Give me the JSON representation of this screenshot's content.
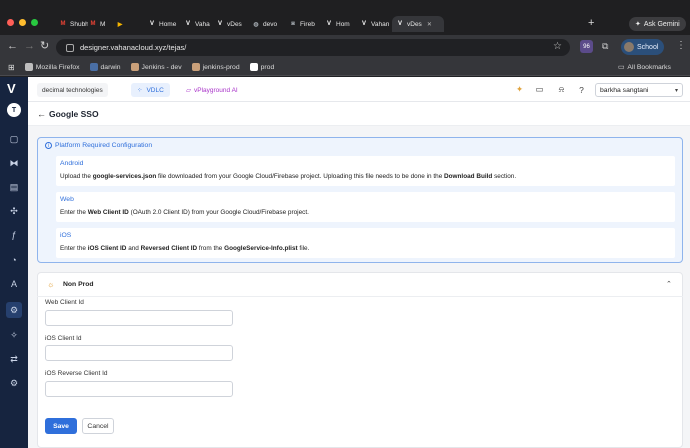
{
  "browser": {
    "tabs": [
      {
        "label": "Shubh",
        "icon": "gmail-icon",
        "color": "#ea4335",
        "glyph": "M"
      },
      {
        "label": "M",
        "icon": "gmail-icon",
        "color": "#ea4335",
        "glyph": "M"
      },
      {
        "label": "",
        "icon": "meet-icon",
        "color": "#f4b400",
        "glyph": "▶"
      },
      {
        "label": "Home",
        "icon": "vahana-icon",
        "color": "#ffffff",
        "glyph": "V"
      },
      {
        "label": "Vaha",
        "icon": "vahana-icon",
        "color": "#ffffff",
        "glyph": "V"
      },
      {
        "label": "vDes",
        "icon": "vahana-icon",
        "color": "#ffffff",
        "glyph": "V"
      },
      {
        "label": "devo",
        "icon": "globe-icon",
        "color": "#9aa0a6",
        "glyph": "◍"
      },
      {
        "label": "Fireb",
        "icon": "firebase-icon",
        "color": "#9aa0a6",
        "glyph": "◙"
      },
      {
        "label": "Hom",
        "icon": "vahana-icon",
        "color": "#ffffff",
        "glyph": "V"
      },
      {
        "label": "Vahan",
        "icon": "vahana-icon",
        "color": "#ffffff",
        "glyph": "V"
      },
      {
        "label": "vDes",
        "icon": "vahana-icon",
        "color": "#ffffff",
        "glyph": "V",
        "active": true
      }
    ],
    "gemini_label": "Ask Gemini",
    "url": "designer.vahanacloud.xyz/tejas/",
    "profile_label": "School",
    "extension_badge": "96",
    "bookmarks": [
      {
        "label": "Mozilla Firefox",
        "icon": "folder-icon",
        "color": "#bdbdbd"
      },
      {
        "label": "darwin",
        "icon": "d-icon",
        "color": "#4a6fa5"
      },
      {
        "label": "Jenkins - dev",
        "icon": "jenkins-icon",
        "color": "#c9a07a"
      },
      {
        "label": "jenkins-prod",
        "icon": "jenkins-icon",
        "color": "#c9a07a"
      },
      {
        "label": "prod",
        "icon": "vahana-icon",
        "color": "#ffffff"
      }
    ],
    "all_bookmarks": "All Bookmarks"
  },
  "app": {
    "org": "decimal technologies",
    "vdlc": "VDLC",
    "vplayground": "vPlayground AI",
    "user": "barkha sangtani",
    "avatar_letter": "T",
    "page_title": "Google SSO",
    "config": {
      "title": "Platform Required Configuration",
      "platforms": [
        {
          "name": "Android",
          "desc": [
            {
              "t": "Upload the "
            },
            {
              "t": "google-services.json",
              "b": true
            },
            {
              "t": " file downloaded from your Google Cloud/Firebase project. Uploading this file needs to be done in the "
            },
            {
              "t": "Download Build",
              "b": true
            },
            {
              "t": " section."
            }
          ]
        },
        {
          "name": "Web",
          "desc": [
            {
              "t": "Enter the "
            },
            {
              "t": "Web Client ID",
              "b": true
            },
            {
              "t": " (OAuth 2.0 Client ID) from your Google Cloud/Firebase project."
            }
          ]
        },
        {
          "name": "iOS",
          "desc": [
            {
              "t": "Enter the "
            },
            {
              "t": "iOS Client ID",
              "b": true
            },
            {
              "t": " and "
            },
            {
              "t": "Reversed Client ID",
              "b": true
            },
            {
              "t": " from the "
            },
            {
              "t": "GoogleService-Info.plist",
              "b": true
            },
            {
              "t": " file."
            }
          ]
        }
      ]
    },
    "form": {
      "env": "Non Prod",
      "fields": [
        {
          "label": "Web Client Id",
          "value": ""
        },
        {
          "label": "iOS Client Id",
          "value": ""
        },
        {
          "label": "iOS Reverse Client Id",
          "value": ""
        }
      ],
      "save": "Save",
      "cancel": "Cancel"
    }
  },
  "colors": {
    "accent": "#2f6fdb",
    "sidebar": "#16243f",
    "vplayground": "#a934c9"
  }
}
